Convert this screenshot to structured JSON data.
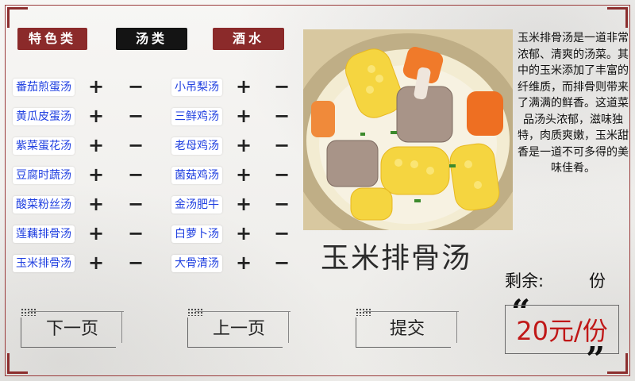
{
  "tabs": [
    {
      "label": "特色类",
      "style": "red"
    },
    {
      "label": "汤类",
      "style": "black"
    },
    {
      "label": "酒水",
      "style": "red"
    }
  ],
  "left_menu": [
    "番茄煎蛋汤",
    "黄瓜皮蛋汤",
    "紫菜蛋花汤",
    "豆腐时蔬汤",
    "酸菜粉丝汤",
    "莲藕排骨汤",
    "玉米排骨汤"
  ],
  "right_menu": [
    "小吊梨汤",
    "三鲜鸡汤",
    "老母鸡汤",
    "菌菇鸡汤",
    "金汤肥牛",
    "白萝卜汤",
    "大骨清汤"
  ],
  "controls": {
    "plus": "+",
    "minus": "−"
  },
  "selected_dish": {
    "title": "玉米排骨汤",
    "description": "玉米排骨汤是一道非常浓郁、清爽的汤菜。其中的玉米添加了丰富的纤维质，而排骨则带来了满满的鲜香。这道菜品汤头浓郁，滋味独特，肉质爽嫩，玉米甜香是一道不可多得的美味佳肴。",
    "remaining_label": "剩余:",
    "remaining_unit": "份",
    "price": "20元/份"
  },
  "buttons": {
    "next": "下一页",
    "prev": "上一页",
    "submit": "提交"
  },
  "colors": {
    "tab_red": "#8b2a2a",
    "tab_black": "#141414",
    "dish_text": "#1f3fe0",
    "price": "#c01818"
  }
}
